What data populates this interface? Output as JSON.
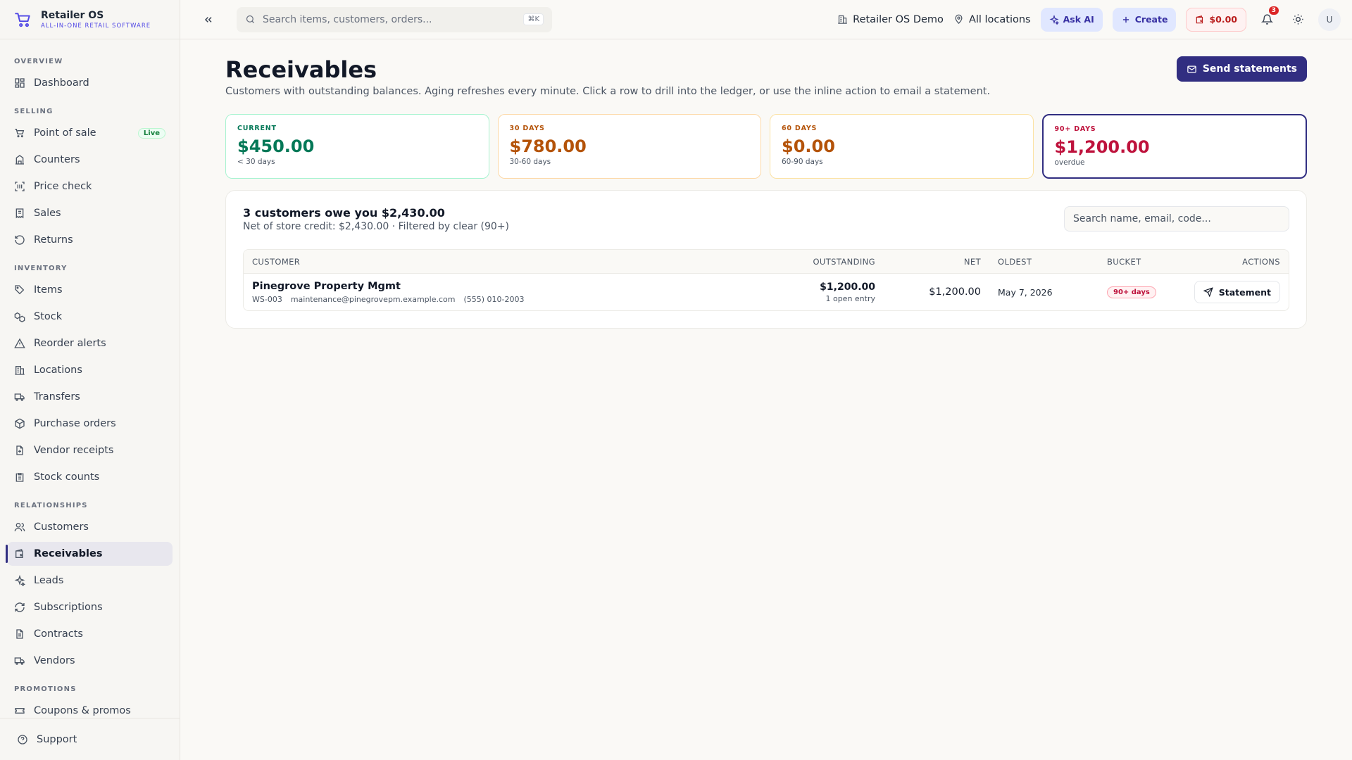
{
  "brand": {
    "name": "Retailer OS",
    "tagline": "ALL-IN-ONE RETAIL SOFTWARE"
  },
  "sidebar": {
    "sections": [
      {
        "title": "OVERVIEW",
        "items": [
          {
            "label": "Dashboard",
            "icon": "grid-icon"
          }
        ]
      },
      {
        "title": "SELLING",
        "items": [
          {
            "label": "Point of sale",
            "icon": "cart-icon",
            "badge": "Live"
          },
          {
            "label": "Counters",
            "icon": "building-icon"
          },
          {
            "label": "Price check",
            "icon": "scan-icon"
          },
          {
            "label": "Sales",
            "icon": "receipt-icon"
          },
          {
            "label": "Returns",
            "icon": "undo-icon"
          }
        ]
      },
      {
        "title": "INVENTORY",
        "items": [
          {
            "label": "Items",
            "icon": "tag-icon"
          },
          {
            "label": "Stock",
            "icon": "boxes-icon"
          },
          {
            "label": "Reorder alerts",
            "icon": "alert-icon"
          },
          {
            "label": "Locations",
            "icon": "building-icon"
          },
          {
            "label": "Transfers",
            "icon": "truck-icon"
          },
          {
            "label": "Purchase orders",
            "icon": "package-icon"
          },
          {
            "label": "Vendor receipts",
            "icon": "file-plus-icon"
          },
          {
            "label": "Stock counts",
            "icon": "clipboard-icon"
          }
        ]
      },
      {
        "title": "RELATIONSHIPS",
        "items": [
          {
            "label": "Customers",
            "icon": "users-icon"
          },
          {
            "label": "Receivables",
            "icon": "wallet-icon",
            "active": true
          },
          {
            "label": "Leads",
            "icon": "sparkle-icon"
          },
          {
            "label": "Subscriptions",
            "icon": "refresh-icon"
          },
          {
            "label": "Contracts",
            "icon": "file-icon"
          },
          {
            "label": "Vendors",
            "icon": "truck-icon"
          }
        ]
      },
      {
        "title": "PROMOTIONS",
        "items": [
          {
            "label": "Coupons & promos",
            "icon": "ticket-icon"
          }
        ]
      }
    ],
    "footer_label": "Support"
  },
  "topbar": {
    "search_placeholder": "Search items, customers, orders...",
    "shortcut": "⌘K",
    "org": "Retailer OS Demo",
    "location": "All locations",
    "ask_ai": "Ask AI",
    "create": "Create",
    "wallet": "$0.00",
    "notifications": "3",
    "avatar": "U"
  },
  "page": {
    "title": "Receivables",
    "description": "Customers with outstanding balances. Aging refreshes every minute. Click a row to drill into the ledger, or use the inline action to email a statement.",
    "send_button": "Send statements"
  },
  "cards": [
    {
      "label": "CURRENT",
      "value": "$450.00",
      "sub": "< 30 days"
    },
    {
      "label": "30 DAYS",
      "value": "$780.00",
      "sub": "30-60 days"
    },
    {
      "label": "60 DAYS",
      "value": "$0.00",
      "sub": "60-90 days"
    },
    {
      "label": "90+ DAYS",
      "value": "$1,200.00",
      "sub": "overdue"
    }
  ],
  "panel": {
    "title": "3 customers owe you $2,430.00",
    "subtitle": "Net of store credit: $2,430.00 · Filtered by clear (90+)",
    "search_placeholder": "Search name, email, code...",
    "columns": {
      "customer": "CUSTOMER",
      "outstanding": "OUTSTANDING",
      "net": "NET",
      "oldest": "OLDEST",
      "bucket": "BUCKET",
      "actions": "ACTIONS"
    },
    "rows": [
      {
        "name": "Pinegrove Property Mgmt",
        "code": "WS-003",
        "email": "maintenance@pinegrovepm.example.com",
        "phone": "(555) 010-2003",
        "outstanding": "$1,200.00",
        "entries": "1 open entry",
        "net": "$1,200.00",
        "oldest": "May 7, 2026",
        "bucket": "90+ days",
        "action": "Statement"
      }
    ]
  },
  "colors": {
    "accent": "#312e81",
    "brand": "#4f46e5",
    "danger": "#be123c",
    "success": "#047857",
    "warning": "#b45309"
  }
}
